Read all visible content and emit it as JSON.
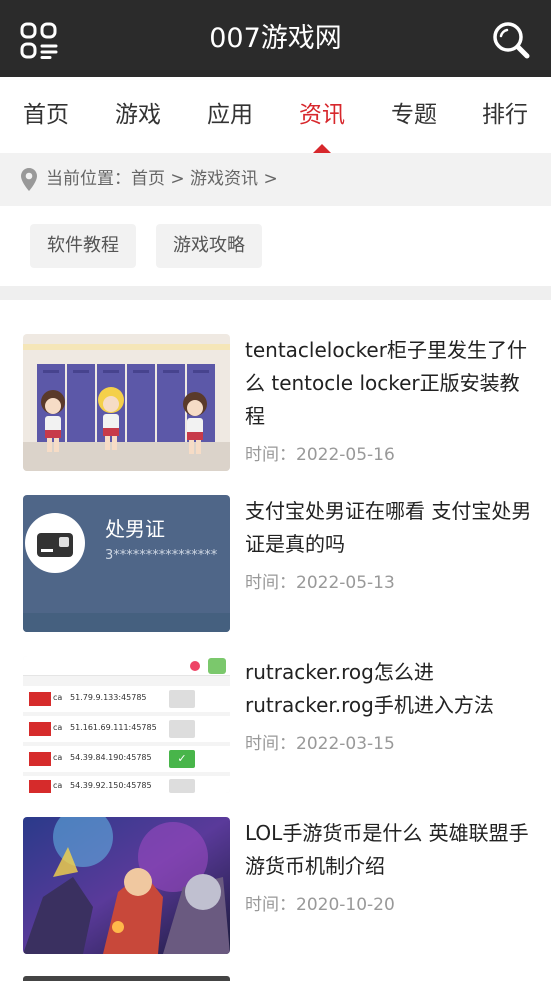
{
  "header": {
    "title": "007游戏网",
    "menu_icon": "menu-grid-icon",
    "search_icon": "search-icon"
  },
  "nav": {
    "tabs": [
      {
        "label": "首页",
        "active": false
      },
      {
        "label": "游戏",
        "active": false
      },
      {
        "label": "应用",
        "active": false
      },
      {
        "label": "资讯",
        "active": true
      },
      {
        "label": "专题",
        "active": false
      },
      {
        "label": "排行",
        "active": false
      }
    ],
    "accent": "#d7272c"
  },
  "breadcrumb": {
    "text": "当前位置：首页 > 游戏资讯 >",
    "icon": "location-pin-icon"
  },
  "filters": [
    "软件教程",
    "游戏攻略"
  ],
  "articles": [
    {
      "title": "tentaclelocker柜子里发生了什么 tentocle locker正版安装教程",
      "date": "时间：2022-05-16"
    },
    {
      "title": "支付宝处男证在哪看 支付宝处男证是真的吗",
      "date": "时间：2022-05-13"
    },
    {
      "title": "rutracker.rog怎么进 rutracker.rog手机进入方法",
      "date": "时间：2022-03-15"
    },
    {
      "title": "LOL手游货币是什么 英雄联盟手游货币机制介绍",
      "date": "时间：2020-10-20"
    }
  ],
  "thumb2": {
    "card_title": "处男证",
    "card_number": "3****************"
  },
  "thumb3": {
    "rows": [
      {
        "flag": "ca",
        "ip": "51.79.9.133:45785",
        "checked": false
      },
      {
        "flag": "ca",
        "ip": "51.161.69.111:45785",
        "checked": false
      },
      {
        "flag": "ca",
        "ip": "54.39.84.190:45785",
        "checked": true
      },
      {
        "flag": "ca",
        "ip": "54.39.92.150:45785",
        "checked": false
      }
    ]
  }
}
